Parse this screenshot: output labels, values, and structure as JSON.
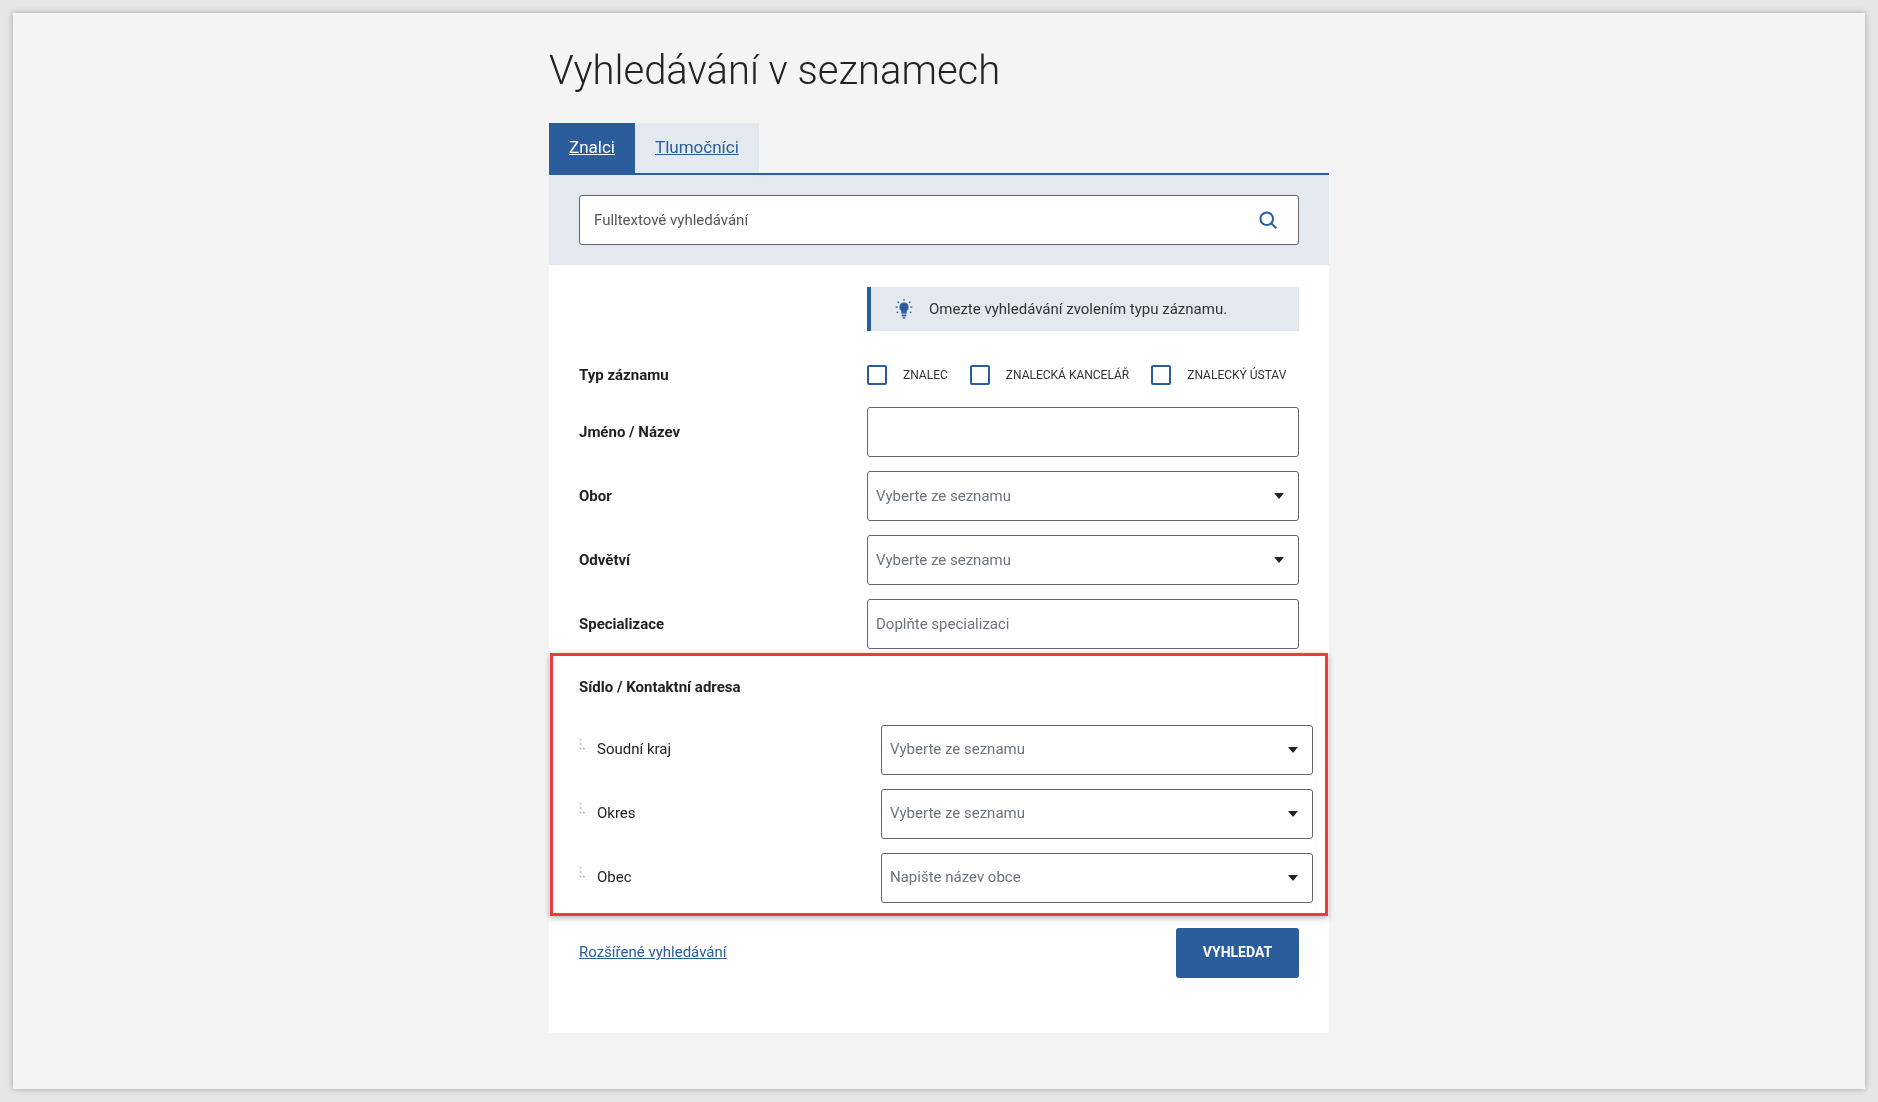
{
  "title": "Vyhledávání v seznamech",
  "tabs": [
    {
      "label": "Znalci",
      "selected": true
    },
    {
      "label": "Tlumočníci",
      "selected": false
    }
  ],
  "search": {
    "placeholder": "Fulltextové vyhledávání"
  },
  "hint": {
    "text": "Omezte vyhledávání zvolením typu záznamu."
  },
  "record_type": {
    "label": "Typ záznamu",
    "options": [
      {
        "label": "ZNALEC",
        "checked": false
      },
      {
        "label": "ZNALECKÁ KANCELÁŘ",
        "checked": false
      },
      {
        "label": "ZNALECKÝ ÚSTAV",
        "checked": false
      }
    ]
  },
  "fields": [
    {
      "label": "Jméno / Název",
      "kind": "text"
    },
    {
      "label": "Obor",
      "kind": "select",
      "placeholder": "Vyberte ze seznamu"
    },
    {
      "label": "Odvětví",
      "kind": "select",
      "placeholder": "Vyberte ze seznamu"
    },
    {
      "label": "Specializace",
      "kind": "text",
      "placeholder": "Doplňte specializaci"
    }
  ],
  "address": {
    "title": "Sídlo / Kontaktní adresa",
    "highlighted": true,
    "fields": [
      {
        "label": "Soudní kraj",
        "kind": "select",
        "placeholder": "Vyberte ze seznamu"
      },
      {
        "label": "Okres",
        "kind": "select",
        "placeholder": "Vyberte ze seznamu"
      },
      {
        "label": "Obec",
        "kind": "select",
        "placeholder": "Napište název obce"
      }
    ]
  },
  "advanced_link": "Rozšířené vyhledávání",
  "submit": "VYHLEDAT"
}
